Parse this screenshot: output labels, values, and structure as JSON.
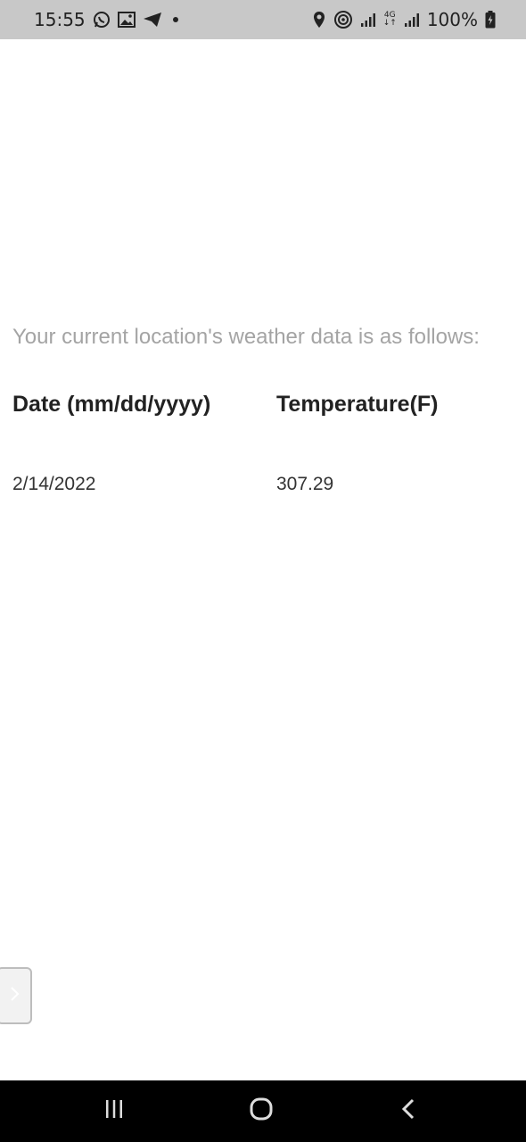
{
  "status_bar": {
    "time": "15:55",
    "battery": "100%",
    "network": "4G",
    "left_icons": [
      "whatsapp-icon",
      "gallery-icon",
      "telegram-icon",
      "dot-icon"
    ],
    "right_icons": [
      "location-icon",
      "hotspot-icon",
      "signal-icon",
      "signal-icon",
      "battery-charging-icon"
    ]
  },
  "main": {
    "intro_text": "Your current location's weather data is as follows:",
    "table": {
      "headers": [
        "Date (mm/dd/yyyy)",
        "Temperature(F)"
      ],
      "rows": [
        [
          "2/14/2022",
          "307.29"
        ]
      ]
    }
  },
  "side_handle": {
    "icon": "chevron-right-icon"
  },
  "nav_bar": {
    "buttons": [
      "recent-apps-icon",
      "home-icon",
      "back-icon"
    ]
  }
}
